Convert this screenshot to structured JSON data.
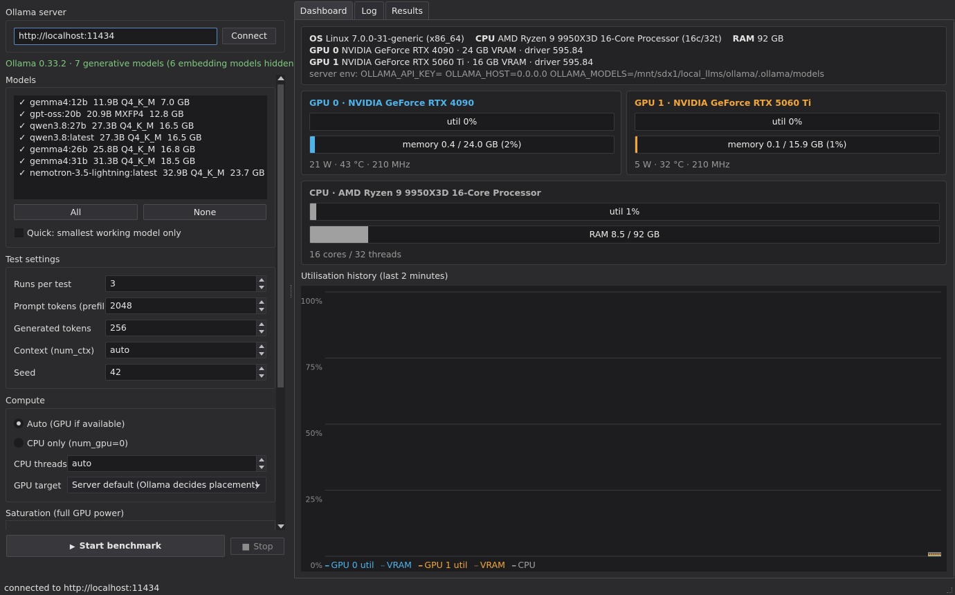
{
  "left": {
    "server_label": "Ollama server",
    "server_url": "http://localhost:11434",
    "connect_label": "Connect",
    "status_line": "Ollama 0.33.2 · 7 generative models (6 embedding models hidden)",
    "models_label": "Models",
    "models": [
      {
        "name": "gemma4:12b",
        "detail": "11.9B Q4_K_M",
        "size": "7.0 GB"
      },
      {
        "name": "gpt-oss:20b",
        "detail": "20.9B MXFP4",
        "size": "12.8 GB"
      },
      {
        "name": "qwen3.8:27b",
        "detail": "27.3B Q4_K_M",
        "size": "16.5 GB"
      },
      {
        "name": "qwen3.8:latest",
        "detail": "27.3B Q4_K_M",
        "size": "16.5 GB"
      },
      {
        "name": "gemma4:26b",
        "detail": "25.8B Q4_K_M",
        "size": "16.8 GB"
      },
      {
        "name": "gemma4:31b",
        "detail": "31.3B Q4_K_M",
        "size": "18.5 GB"
      },
      {
        "name": "nemotron-3.5-lightning:latest",
        "detail": "32.9B Q4_K_M",
        "size": "23.7 GB"
      }
    ],
    "check_mark": "✓",
    "all_label": "All",
    "none_label": "None",
    "quick_label": "Quick: smallest working model only",
    "test_settings_label": "Test settings",
    "settings": [
      {
        "label": "Runs per test",
        "value": "3"
      },
      {
        "label": "Prompt tokens (prefill)",
        "value": "2048"
      },
      {
        "label": "Generated tokens",
        "value": "256"
      },
      {
        "label": "Context (num_ctx)",
        "value": "auto"
      },
      {
        "label": "Seed",
        "value": "42"
      }
    ],
    "compute_label": "Compute",
    "radio_auto": "Auto (GPU if available)",
    "radio_cpu": "CPU only (num_gpu=0)",
    "cpu_threads_label": "CPU threads",
    "cpu_threads_value": "auto",
    "gpu_target_label": "GPU target",
    "gpu_target_value": "Server default (Ollama decides placement)",
    "saturation_label": "Saturation (full GPU power)",
    "start_label": "Start benchmark",
    "start_icon": "▶",
    "stop_label": "Stop",
    "stop_icon": "■"
  },
  "status_bar": "connected to http://localhost:11434",
  "tabs": [
    "Dashboard",
    "Log",
    "Results"
  ],
  "sysinfo": {
    "os_key": "OS",
    "os_val": "Linux 7.0.0-31-generic (x86_64)",
    "cpu_key": "CPU",
    "cpu_val": "AMD Ryzen 9 9950X3D 16-Core Processor (16c/32t)",
    "ram_key": "RAM",
    "ram_val": "92 GB",
    "gpu0_key": "GPU 0",
    "gpu0_val": "NVIDIA GeForce RTX 4090 · 24 GB VRAM · driver 595.84",
    "gpu1_key": "GPU 1",
    "gpu1_val": "NVIDIA GeForce RTX 5060 Ti · 16 GB VRAM · driver 595.84",
    "env": "server env: OLLAMA_API_KEY= OLLAMA_HOST=0.0.0.0 OLLAMA_MODELS=/mnt/sdx1/local_llms/ollama/.ollama/models"
  },
  "gpu0": {
    "title": "GPU 0 · NVIDIA GeForce RTX 4090",
    "color": "#4fb3ea",
    "util": "util 0%",
    "util_frac": 0.0,
    "memory": "memory 0.4 / 24.0 GB (2%)",
    "mem_frac": 0.017,
    "footer": "21 W · 43 °C · 210 MHz"
  },
  "gpu1": {
    "title": "GPU 1 · NVIDIA GeForce RTX 5060 Ti",
    "color": "#f2a63a",
    "util": "util 0%",
    "util_frac": 0.0,
    "memory": "memory 0.1 / 15.9 GB (1%)",
    "mem_frac": 0.006,
    "footer": "5 W · 32 °C · 210 MHz"
  },
  "cpu": {
    "title": "CPU · AMD Ryzen 9 9950X3D 16-Core Processor",
    "util": "util 1%",
    "util_frac": 0.01,
    "ram": "RAM 8.5 / 92 GB",
    "ram_frac": 0.092,
    "footer": "16 cores / 32 threads",
    "color": "#a0a0a0"
  },
  "history": {
    "title": "Utilisation history (last 2 minutes)",
    "y_ticks": [
      "100%",
      "75%",
      "50%",
      "25%",
      "0%"
    ],
    "y_values": [
      100,
      75,
      50,
      25,
      0
    ],
    "legend": [
      {
        "label": "GPU 0 util",
        "color": "#4fb3ea",
        "style": "solid"
      },
      {
        "label": "VRAM",
        "color": "#4fb3ea",
        "style": "dashed"
      },
      {
        "label": "GPU 1 util",
        "color": "#f2a63a",
        "style": "solid"
      },
      {
        "label": "VRAM",
        "color": "#f2a63a",
        "style": "dashed"
      },
      {
        "label": "CPU",
        "color": "#a0a0a0",
        "style": "solid"
      }
    ]
  }
}
